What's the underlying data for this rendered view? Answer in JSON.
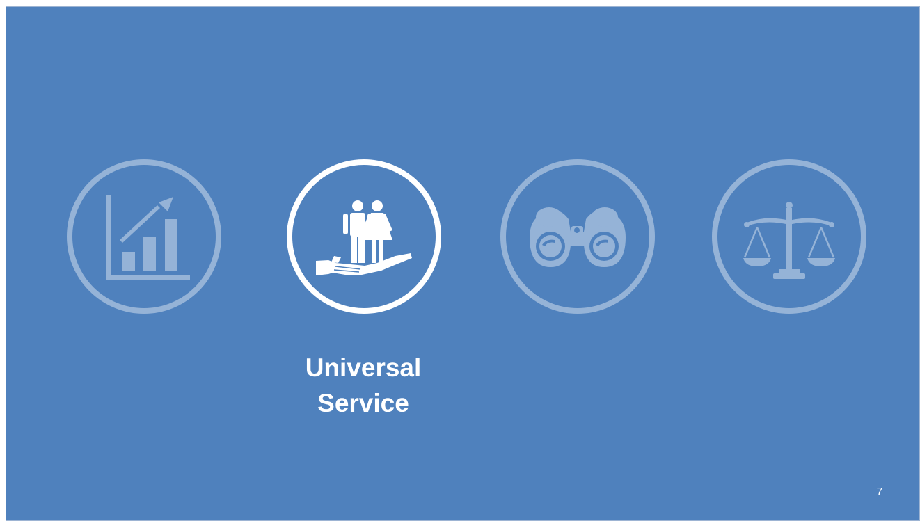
{
  "slide": {
    "background_color": "#4f81bd",
    "inactive_icon_color": "#95b3d7",
    "active_icon_color": "#ffffff",
    "page_number": "7"
  },
  "icons": [
    {
      "name": "growth-chart-icon",
      "active": false
    },
    {
      "name": "people-in-hand-icon",
      "active": true
    },
    {
      "name": "binoculars-icon",
      "active": false
    },
    {
      "name": "balance-scale-icon",
      "active": false
    }
  ],
  "active_label": {
    "line1": "Universal",
    "line2": "Service"
  }
}
